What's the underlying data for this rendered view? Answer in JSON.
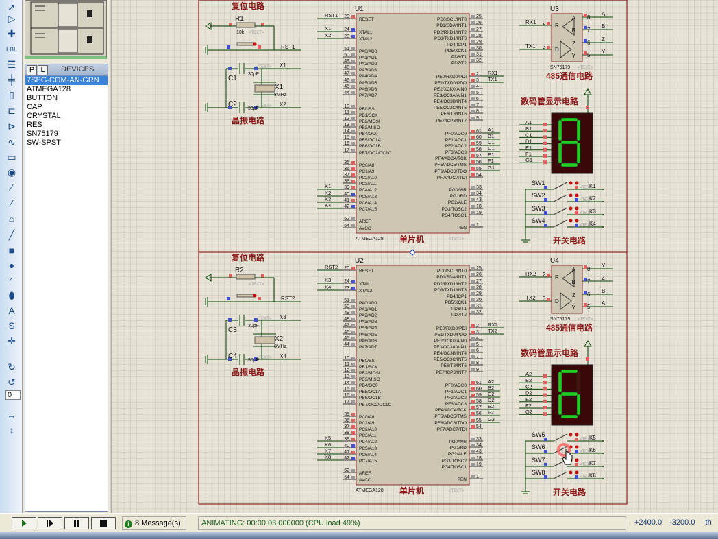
{
  "toolbar": {
    "tools": [
      "selection-mode",
      "component-mode",
      "junction-dot",
      "wire-label",
      "text-script",
      "bus",
      "subcircuit",
      "terminals",
      "device-pins",
      "graph",
      "tape-recorder",
      "generator",
      "voltage-probe",
      "current-probe",
      "virtual-instruments",
      "line",
      "box",
      "circle",
      "arc",
      "path",
      "text",
      "symbol",
      "marker",
      "rotate-clockwise",
      "rotate-anticlockwise",
      "mirror-horizontal",
      "mirror-vertical"
    ],
    "rotation_value": "0"
  },
  "panel": {
    "pick_label": "P",
    "library_label": "L",
    "devices_title": "DEVICES",
    "devices": [
      "7SEG-COM-AN-GRN",
      "ATMEGA128",
      "BUTTON",
      "CAP",
      "CRYSTAL",
      "RES",
      "SN75179",
      "SW-SPST"
    ],
    "selected_index": 0
  },
  "chip_pins": {
    "left": [
      [
        "20",
        "RESET"
      ],
      [
        "24",
        "XTAL1"
      ],
      [
        "23",
        "XTAL2"
      ],
      [
        "51",
        "PA0/AD0"
      ],
      [
        "50",
        "PA1/AD1"
      ],
      [
        "49",
        "PA2/AD2"
      ],
      [
        "48",
        "PA3/AD3"
      ],
      [
        "47",
        "PA4/AD4"
      ],
      [
        "46",
        "PA5/AD5"
      ],
      [
        "45",
        "PA6/AD6"
      ],
      [
        "44",
        "PA7/AD7"
      ],
      [
        "10",
        "PB0/SS"
      ],
      [
        "11",
        "PB1/SCK"
      ],
      [
        "12",
        "PB2/MOSI"
      ],
      [
        "13",
        "PB3/MISO"
      ],
      [
        "14",
        "PB4/OC0"
      ],
      [
        "15",
        "PB5/OC1A"
      ],
      [
        "16",
        "PB6/OC1B"
      ],
      [
        "17",
        "PB7/OC2/OC1C"
      ],
      [
        "35",
        "PC0/A8"
      ],
      [
        "36",
        "PC1/A9"
      ],
      [
        "37",
        "PC2/A10"
      ],
      [
        "38",
        "PC3/A11"
      ],
      [
        "39",
        "PC4/A12"
      ],
      [
        "40",
        "PC5/A13"
      ],
      [
        "41",
        "PC6/A14"
      ],
      [
        "42",
        "PC7/A15"
      ],
      [
        "62",
        "AREF"
      ],
      [
        "64",
        "AVCC"
      ]
    ],
    "right": [
      [
        "25",
        "PD0/SCL/INT0"
      ],
      [
        "26",
        "PD1/SDA/INT1"
      ],
      [
        "27",
        "PD2/RXD1/INT2"
      ],
      [
        "28",
        "PD3/TXD1/INT3"
      ],
      [
        "29",
        "PD4/ICP1"
      ],
      [
        "30",
        "PD5/XCK1"
      ],
      [
        "31",
        "PD6/T1"
      ],
      [
        "32",
        "PD7/T2"
      ],
      [
        "2",
        "PE0/RXD0/PDI"
      ],
      [
        "3",
        "PE1/TXD0/PDO"
      ],
      [
        "4",
        "PE2/XCK0/AIN0"
      ],
      [
        "5",
        "PE3/OC3A/AIN1"
      ],
      [
        "6",
        "PE4/OC3B/INT4"
      ],
      [
        "7",
        "PE5/OC3C/INT5"
      ],
      [
        "8",
        "PE6/T3/INT6"
      ],
      [
        "9",
        "PE7/ICP3/INT7"
      ],
      [
        "61",
        "PF0/ADC0"
      ],
      [
        "60",
        "PF1/ADC1"
      ],
      [
        "59",
        "PF2/ADC2"
      ],
      [
        "58",
        "PF3/ADC3"
      ],
      [
        "57",
        "PF4/ADC4/TCK"
      ],
      [
        "56",
        "PF5/ADC5/TMS"
      ],
      [
        "55",
        "PF6/ADC6/TDO"
      ],
      [
        "54",
        "PF7/ADC7/TDI"
      ],
      [
        "33",
        "PG0/WR"
      ],
      [
        "34",
        "PG1/RD"
      ],
      [
        "43",
        "PG2/ALE"
      ],
      [
        "18",
        "PG3/TOSC2"
      ],
      [
        "19",
        "PG4/TOSC1"
      ],
      [
        "1",
        "PEN"
      ]
    ]
  },
  "placeholder_text": "<TEXT>",
  "blocks": [
    {
      "reset_title": "复位电路",
      "res_ref": "R1",
      "res_value": "10k",
      "reset_net": "RST1",
      "crystal_title": "晶振电路",
      "cap_refs": [
        "C1",
        "C2"
      ],
      "cap_value": "30pF",
      "xtal_ref": "X1",
      "xtal_value": "8MHz",
      "xtal_nets": [
        "X1",
        "X2"
      ],
      "chip_ref": "U1",
      "chip_type": "ATMEGA128",
      "chip_title": "单片机",
      "uart_nets": [
        "RX1",
        "TX1"
      ],
      "seg_nets": [
        "A1",
        "B1",
        "C1",
        "D1",
        "E1",
        "F1",
        "G1"
      ],
      "key_nets": [
        "K1",
        "K2",
        "K3",
        "K4"
      ],
      "driver_ref": "U3",
      "driver_type": "SN75179",
      "driver_title": "485通信电路",
      "driver_pins": {
        "in": [
          [
            "2",
            "R"
          ],
          [
            "3",
            "D"
          ]
        ],
        "out": [
          [
            "8",
            "A"
          ],
          [
            "7",
            "B"
          ],
          [
            "6",
            "Z"
          ],
          [
            "5",
            "Y"
          ]
        ]
      },
      "bus_nets": [
        "A",
        "B",
        "Z",
        "Y"
      ],
      "display_title": "数码管显示电路",
      "display_digit": "8",
      "switch_refs": [
        "SW1",
        "SW2",
        "SW3",
        "SW4"
      ],
      "switch_title": "开关电路"
    },
    {
      "reset_title": "复位电路",
      "res_ref": "R2",
      "res_value": "",
      "reset_net": "RST2",
      "crystal_title": "晶振电路",
      "cap_refs": [
        "C3",
        "C4"
      ],
      "cap_value": "30pF",
      "xtal_ref": "X2",
      "xtal_value": "8MHz",
      "xtal_nets": [
        "X3",
        "X4"
      ],
      "chip_ref": "U2",
      "chip_type": "ATMEGA128",
      "chip_title": "单片机",
      "uart_nets": [
        "RX2",
        "TX2"
      ],
      "seg_nets": [
        "A2",
        "B2",
        "C2",
        "D2",
        "E2",
        "F2",
        "G2"
      ],
      "key_nets": [
        "K5",
        "K6",
        "K7",
        "K8"
      ],
      "driver_ref": "U4",
      "driver_type": "SN75179",
      "driver_title": "485通信电路",
      "driver_pins": {
        "in": [
          [
            "2",
            "R"
          ],
          [
            "3",
            "D"
          ]
        ],
        "out": [
          [
            "8",
            "A"
          ],
          [
            "7",
            "B"
          ],
          [
            "6",
            "Z"
          ],
          [
            "5",
            "Y"
          ]
        ]
      },
      "bus_nets": [
        "Y",
        "Z",
        "B",
        "A"
      ],
      "display_title": "数码管显示电路",
      "display_digit": "6",
      "switch_refs": [
        "SW5",
        "SW6",
        "SW7",
        "SW8"
      ],
      "switch_title": "开关电路"
    }
  ],
  "colors": {
    "wire": "#004000",
    "frame": "#800000",
    "title": "#8b1a1a",
    "chip_fill": "#cdc6b2",
    "pin_red": "#e06060",
    "pin_blue": "#4050d0",
    "seg_on": "#22cc22",
    "seg_off": "#4a1010",
    "display_bg": "#3a0808"
  },
  "status": {
    "controls": [
      "play",
      "step",
      "pause",
      "stop"
    ],
    "messages": "8 Message(s)",
    "animation": "ANIMATING: 00:00:03.000000 (CPU load 49%)",
    "x_coord": "+2400.0",
    "y_coord": "-3200.0",
    "units": "th"
  }
}
